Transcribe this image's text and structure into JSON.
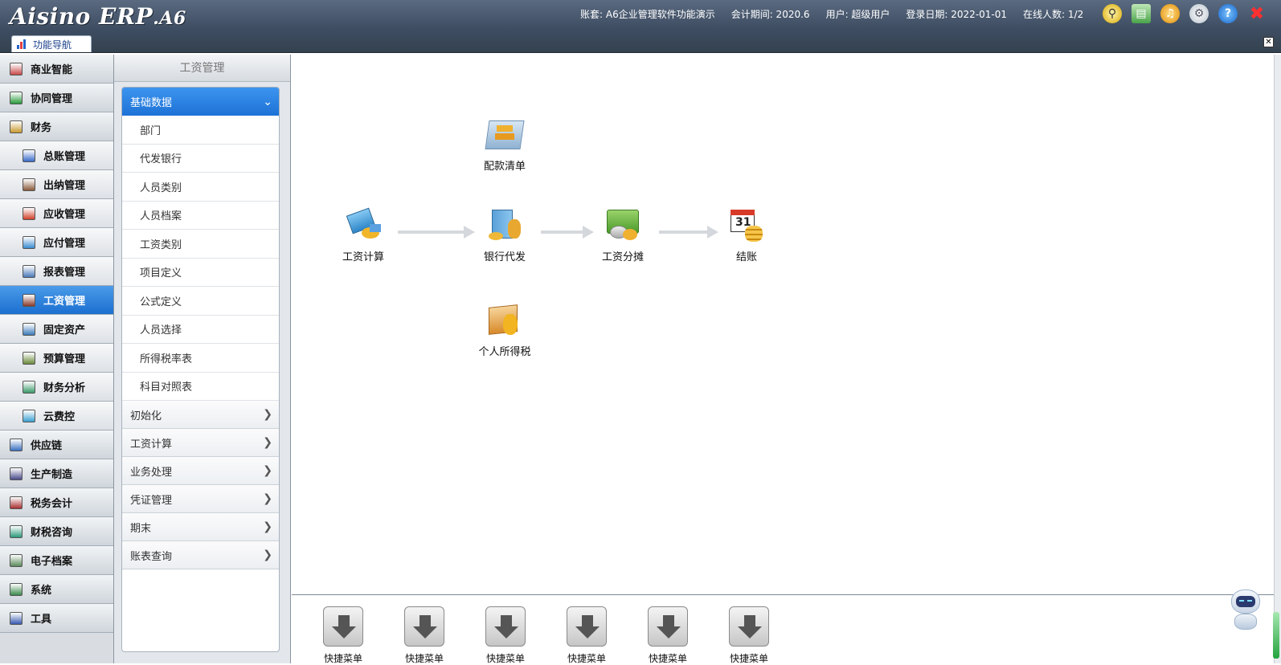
{
  "app": {
    "logo_main": "Aisino ERP",
    "logo_suffix": ".A6",
    "info": {
      "account": "账套: A6企业管理软件功能演示",
      "period": "会计期间: 2020.6",
      "user": "用户: 超级用户",
      "login_date": "登录日期: 2022-01-01",
      "online": "在线人数: 1/2"
    },
    "toolbar_icons": [
      "search-icon",
      "notebook-icon",
      "bell-icon",
      "gear-icon",
      "help-icon",
      "close-icon"
    ],
    "tab_label": "功能导航"
  },
  "leftnav": {
    "items": [
      {
        "label": "商业智能",
        "level": "top"
      },
      {
        "label": "协同管理",
        "level": "top"
      },
      {
        "label": "财务",
        "level": "top"
      },
      {
        "label": "总账管理",
        "level": "sub"
      },
      {
        "label": "出纳管理",
        "level": "sub"
      },
      {
        "label": "应收管理",
        "level": "sub"
      },
      {
        "label": "应付管理",
        "level": "sub"
      },
      {
        "label": "报表管理",
        "level": "sub"
      },
      {
        "label": "工资管理",
        "level": "sub",
        "active": true
      },
      {
        "label": "固定资产",
        "level": "sub"
      },
      {
        "label": "预算管理",
        "level": "sub"
      },
      {
        "label": "财务分析",
        "level": "sub"
      },
      {
        "label": "云费控",
        "level": "sub"
      },
      {
        "label": "供应链",
        "level": "top"
      },
      {
        "label": "生产制造",
        "level": "top"
      },
      {
        "label": "税务会计",
        "level": "top"
      },
      {
        "label": "财税咨询",
        "level": "top"
      },
      {
        "label": "电子档案",
        "level": "top"
      },
      {
        "label": "系统",
        "level": "top"
      },
      {
        "label": "工具",
        "level": "top"
      }
    ]
  },
  "submenu": {
    "title": "工资管理",
    "expanded_group": "基础数据",
    "expanded_items": [
      "部门",
      "代发银行",
      "人员类别",
      "人员档案",
      "工资类别",
      "项目定义",
      "公式定义",
      "人员选择",
      "所得税率表",
      "科目对照表"
    ],
    "groups": [
      "初始化",
      "工资计算",
      "业务处理",
      "凭证管理",
      "期末",
      "账表查询"
    ]
  },
  "flow": {
    "nodes": {
      "peikuan": "配款清单",
      "gongzi_jisuan": "工资计算",
      "yinhang_daifa": "银行代发",
      "gongzi_fentan": "工资分摊",
      "jiezhang": "结账",
      "geren_suodeshui": "个人所得税"
    }
  },
  "quickbar": {
    "buttons": [
      "快捷菜单",
      "快捷菜单",
      "快捷菜单",
      "快捷菜单",
      "快捷菜单",
      "快捷菜单"
    ]
  },
  "colors": {
    "title_bg": "#3e4d62",
    "active_blue": "#1b6fd0",
    "arrow_gray": "#d4d8dc"
  }
}
